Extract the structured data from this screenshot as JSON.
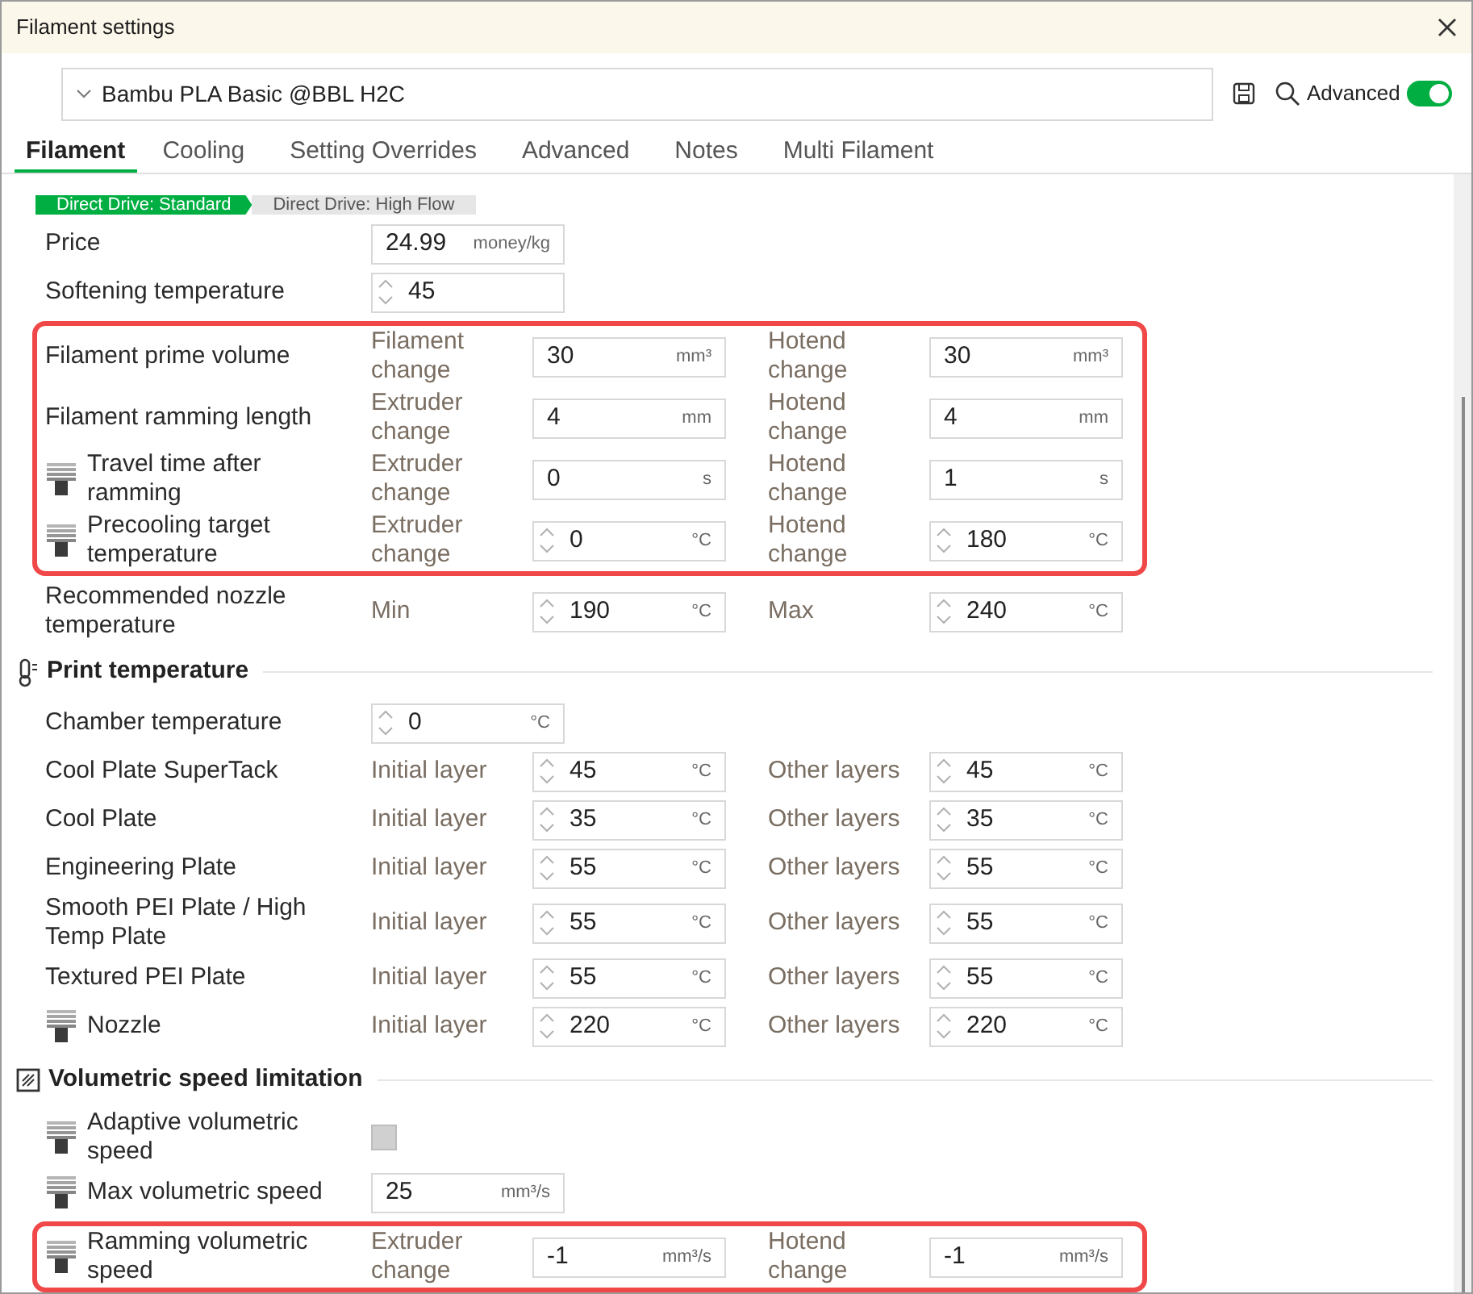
{
  "window": {
    "title": "Filament settings"
  },
  "preset": {
    "value": "Bambu PLA Basic @BBL H2C"
  },
  "advanced_toggle": {
    "label": "Advanced",
    "on": true
  },
  "tabs": [
    {
      "label": "Filament",
      "selected": true
    },
    {
      "label": "Cooling",
      "selected": false
    },
    {
      "label": "Setting Overrides",
      "selected": false
    },
    {
      "label": "Advanced",
      "selected": false
    },
    {
      "label": "Notes",
      "selected": false
    },
    {
      "label": "Multi Filament",
      "selected": false
    }
  ],
  "variants": [
    {
      "label": "Direct Drive: Standard",
      "selected": true
    },
    {
      "label": "Direct Drive: High Flow",
      "selected": false
    }
  ],
  "sections": [
    {
      "groups": [
        {
          "highlighted": false,
          "rows": [
            {
              "label": "Price",
              "nozzle_icon": false,
              "fields": [
                {
                  "kind": "input",
                  "value": "24.99",
                  "unit": "money/kg",
                  "spinner": false
                }
              ]
            },
            {
              "label": "Softening temperature",
              "nozzle_icon": false,
              "fields": [
                {
                  "kind": "input",
                  "value": "45",
                  "spinner": true
                }
              ]
            }
          ]
        },
        {
          "highlighted": true,
          "rows": [
            {
              "label": "Filament prime volume",
              "nozzle_icon": false,
              "fields": [
                {
                  "kind": "input",
                  "caption": "Filament change",
                  "value": "30",
                  "unit": "mm³",
                  "spinner": false
                },
                {
                  "kind": "input",
                  "caption": "Hotend change",
                  "value": "30",
                  "unit": "mm³",
                  "spinner": false
                }
              ]
            },
            {
              "label": "Filament ramming length",
              "nozzle_icon": false,
              "fields": [
                {
                  "kind": "input",
                  "caption": "Extruder change",
                  "value": "4",
                  "unit": "mm",
                  "spinner": false
                },
                {
                  "kind": "input",
                  "caption": "Hotend change",
                  "value": "4",
                  "unit": "mm",
                  "spinner": false
                }
              ]
            },
            {
              "label": "Travel time after ramming",
              "nozzle_icon": true,
              "fields": [
                {
                  "kind": "input",
                  "caption": "Extruder change",
                  "value": "0",
                  "unit": "s",
                  "spinner": false
                },
                {
                  "kind": "input",
                  "caption": "Hotend change",
                  "value": "1",
                  "unit": "s",
                  "spinner": false
                }
              ]
            },
            {
              "label": "Precooling target temperature",
              "nozzle_icon": true,
              "fields": [
                {
                  "kind": "input",
                  "caption": "Extruder change",
                  "value": "0",
                  "unit": "°C",
                  "spinner": true
                },
                {
                  "kind": "input",
                  "caption": "Hotend change",
                  "value": "180",
                  "unit": "°C",
                  "spinner": true
                }
              ]
            }
          ]
        },
        {
          "highlighted": false,
          "rows": [
            {
              "label": "Recommended nozzle temperature",
              "nozzle_icon": false,
              "fields": [
                {
                  "kind": "input",
                  "caption": "Min",
                  "value": "190",
                  "unit": "°C",
                  "spinner": true
                },
                {
                  "kind": "input",
                  "caption": "Max",
                  "value": "240",
                  "unit": "°C",
                  "spinner": true
                }
              ]
            }
          ]
        }
      ]
    },
    {
      "title": "Print temperature",
      "groups": [
        {
          "highlighted": false,
          "rows": [
            {
              "label": "Chamber temperature",
              "nozzle_icon": false,
              "fields": [
                {
                  "kind": "input",
                  "value": "0",
                  "unit": "°C",
                  "spinner": true
                }
              ]
            },
            {
              "label": "Cool Plate SuperTack",
              "nozzle_icon": false,
              "fields": [
                {
                  "kind": "input",
                  "caption": "Initial layer",
                  "value": "45",
                  "unit": "°C",
                  "spinner": true
                },
                {
                  "kind": "input",
                  "caption": "Other layers",
                  "value": "45",
                  "unit": "°C",
                  "spinner": true
                }
              ]
            },
            {
              "label": "Cool Plate",
              "nozzle_icon": false,
              "fields": [
                {
                  "kind": "input",
                  "caption": "Initial layer",
                  "value": "35",
                  "unit": "°C",
                  "spinner": true
                },
                {
                  "kind": "input",
                  "caption": "Other layers",
                  "value": "35",
                  "unit": "°C",
                  "spinner": true
                }
              ]
            },
            {
              "label": "Engineering Plate",
              "nozzle_icon": false,
              "fields": [
                {
                  "kind": "input",
                  "caption": "Initial layer",
                  "value": "55",
                  "unit": "°C",
                  "spinner": true
                },
                {
                  "kind": "input",
                  "caption": "Other layers",
                  "value": "55",
                  "unit": "°C",
                  "spinner": true
                }
              ]
            },
            {
              "label": "Smooth PEI Plate / High Temp Plate",
              "nozzle_icon": false,
              "fields": [
                {
                  "kind": "input",
                  "caption": "Initial layer",
                  "value": "55",
                  "unit": "°C",
                  "spinner": true
                },
                {
                  "kind": "input",
                  "caption": "Other layers",
                  "value": "55",
                  "unit": "°C",
                  "spinner": true
                }
              ]
            },
            {
              "label": "Textured PEI Plate",
              "nozzle_icon": false,
              "fields": [
                {
                  "kind": "input",
                  "caption": "Initial layer",
                  "value": "55",
                  "unit": "°C",
                  "spinner": true
                },
                {
                  "kind": "input",
                  "caption": "Other layers",
                  "value": "55",
                  "unit": "°C",
                  "spinner": true
                }
              ]
            },
            {
              "label": "Nozzle",
              "nozzle_icon": true,
              "fields": [
                {
                  "kind": "input",
                  "caption": "Initial layer",
                  "value": "220",
                  "unit": "°C",
                  "spinner": true
                },
                {
                  "kind": "input",
                  "caption": "Other layers",
                  "value": "220",
                  "unit": "°C",
                  "spinner": true
                }
              ]
            }
          ]
        }
      ]
    },
    {
      "title": "Volumetric speed limitation",
      "groups": [
        {
          "highlighted": false,
          "rows": [
            {
              "label": "Adaptive volumetric speed",
              "nozzle_icon": true,
              "fields": [
                {
                  "kind": "checkbox",
                  "checked": false
                }
              ]
            },
            {
              "label": "Max volumetric speed",
              "nozzle_icon": true,
              "fields": [
                {
                  "kind": "input",
                  "value": "25",
                  "unit": "mm³/s",
                  "spinner": false
                }
              ]
            }
          ]
        },
        {
          "highlighted": true,
          "rows": [
            {
              "label": "Ramming volumetric speed",
              "nozzle_icon": true,
              "fields": [
                {
                  "kind": "input",
                  "caption": "Extruder change",
                  "value": "-1",
                  "unit": "mm³/s",
                  "spinner": false
                },
                {
                  "kind": "input",
                  "caption": "Hotend change",
                  "value": "-1",
                  "unit": "mm³/s",
                  "spinner": false
                }
              ]
            }
          ]
        }
      ]
    }
  ]
}
